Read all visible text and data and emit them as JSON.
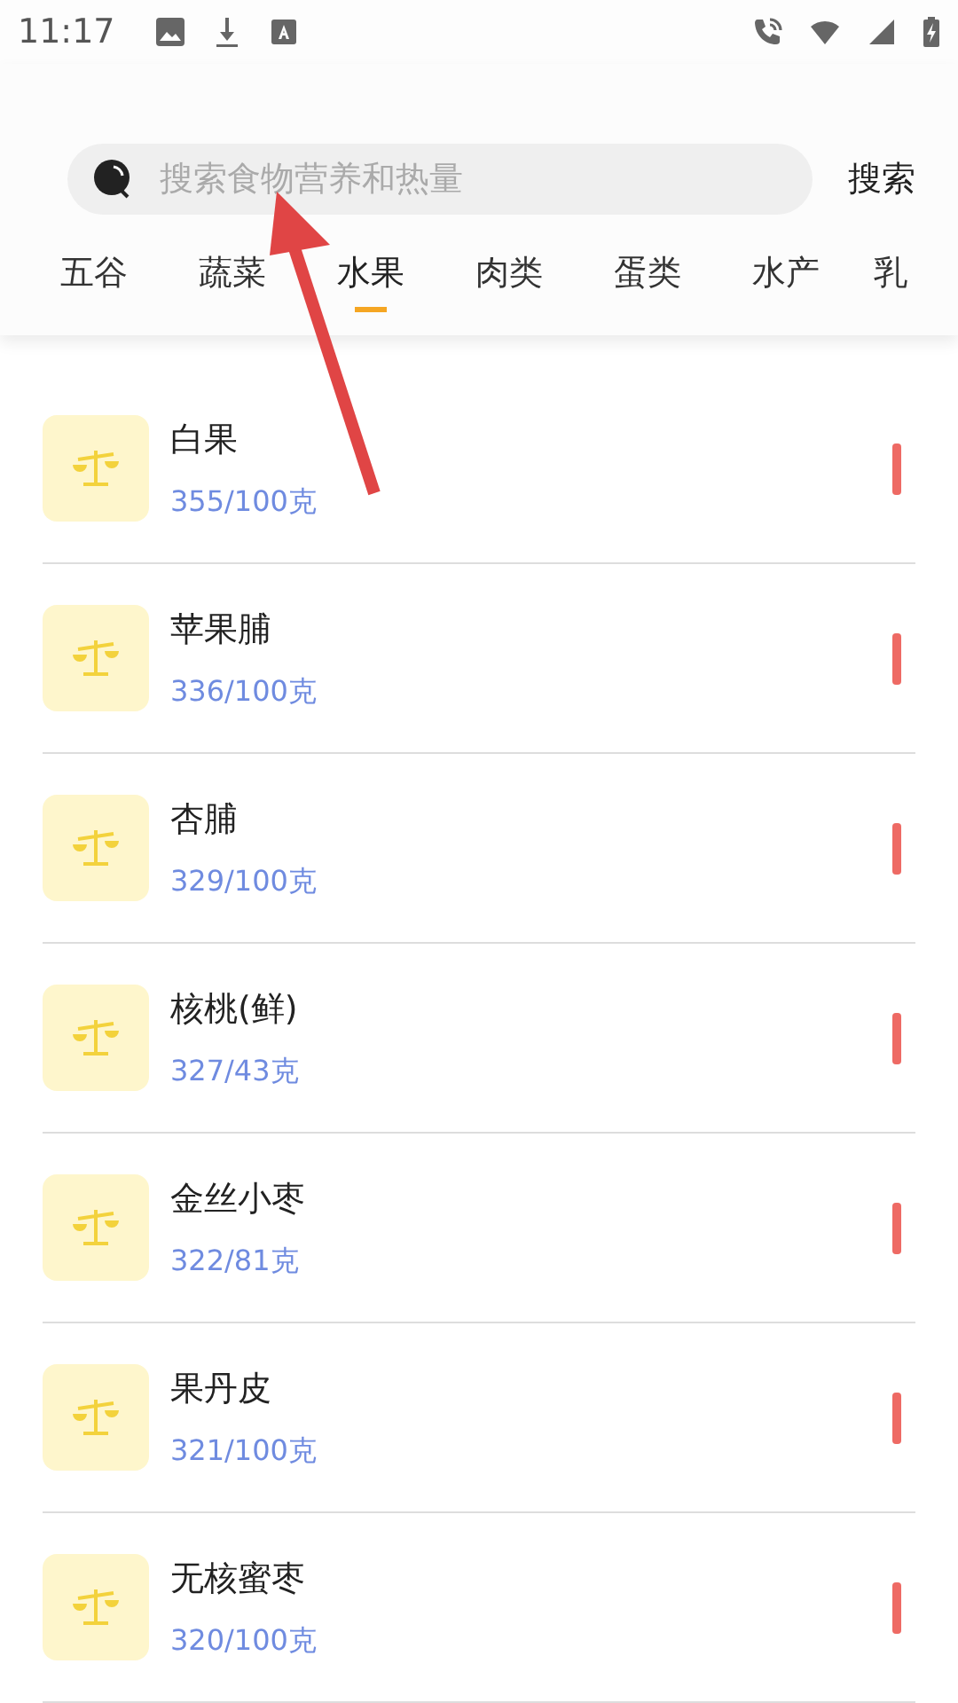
{
  "status_bar": {
    "time": "11:17"
  },
  "search": {
    "placeholder": "搜索食物营养和热量",
    "button": "搜索"
  },
  "tabs": [
    {
      "label": "五谷",
      "selected": false
    },
    {
      "label": "蔬菜",
      "selected": false
    },
    {
      "label": "水果",
      "selected": true
    },
    {
      "label": "肉类",
      "selected": false
    },
    {
      "label": "蛋类",
      "selected": false
    },
    {
      "label": "水产",
      "selected": false
    },
    {
      "label": "乳",
      "selected": false
    }
  ],
  "foods": [
    {
      "name": "白果",
      "calories": "355/100克"
    },
    {
      "name": "苹果脯",
      "calories": "336/100克"
    },
    {
      "name": "杏脯",
      "calories": "329/100克"
    },
    {
      "name": "核桃(鲜)",
      "calories": "327/43克"
    },
    {
      "name": "金丝小枣",
      "calories": "322/81克"
    },
    {
      "name": "果丹皮",
      "calories": "321/100克"
    },
    {
      "name": "无核蜜枣",
      "calories": "320/100克"
    }
  ]
}
